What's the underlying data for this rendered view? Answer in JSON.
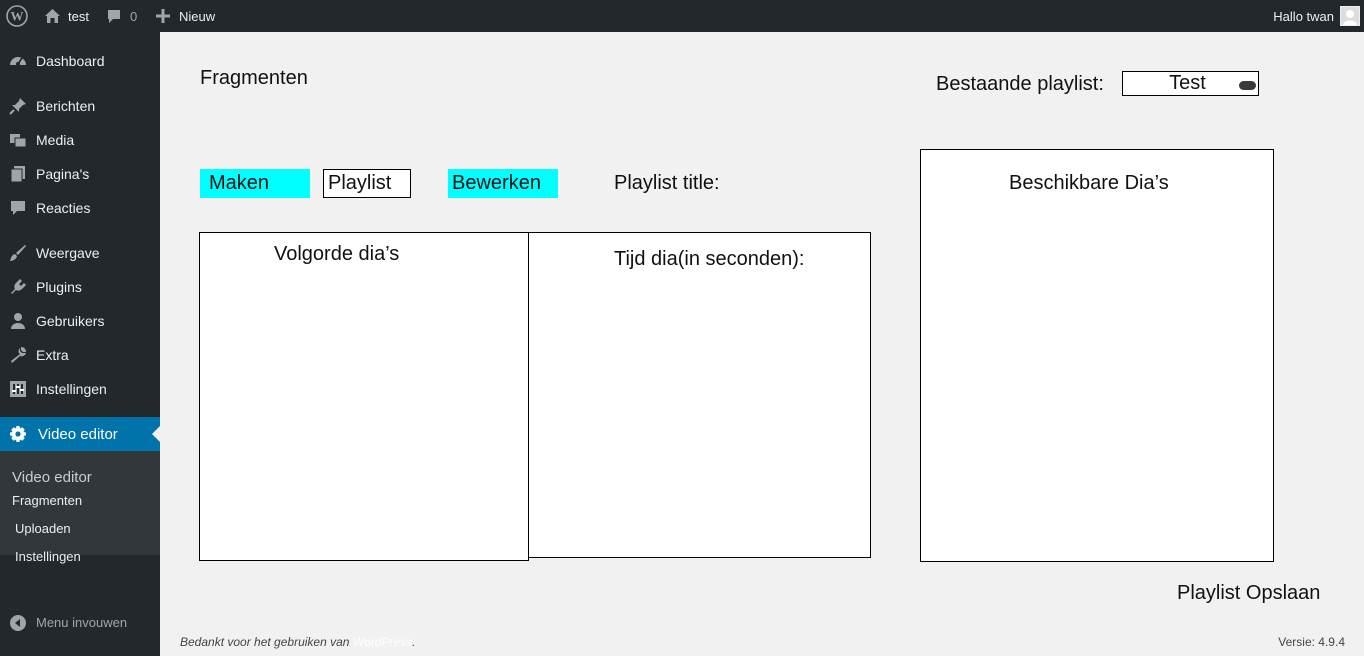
{
  "adminbar": {
    "site_name": "test",
    "comments_count": "0",
    "new_label": "Nieuw",
    "greeting": "Hallo twan"
  },
  "sidebar": {
    "items": [
      {
        "label": "Dashboard",
        "icon": "dashboard-icon"
      },
      {
        "label": "Berichten",
        "icon": "pin-icon"
      },
      {
        "label": "Media",
        "icon": "media-icon"
      },
      {
        "label": "Pagina's",
        "icon": "pages-icon"
      },
      {
        "label": "Reacties",
        "icon": "comment-icon"
      },
      {
        "label": "Weergave",
        "icon": "brush-icon"
      },
      {
        "label": "Plugins",
        "icon": "plugin-icon"
      },
      {
        "label": "Gebruikers",
        "icon": "user-icon"
      },
      {
        "label": "Extra",
        "icon": "wrench-icon"
      },
      {
        "label": "Instellingen",
        "icon": "settings-icon"
      }
    ],
    "active": {
      "label": "Video editor",
      "icon": "gear-icon"
    },
    "submenu_title": "Video editor",
    "submenu": [
      "Fragmenten",
      "Uploaden",
      "Instellingen"
    ],
    "collapse_label": "Menu invouwen"
  },
  "main": {
    "title": "Fragmenten",
    "existing_playlist_label": "Bestaande playlist:",
    "existing_playlist_value": "Test",
    "buttons": {
      "maken": "Maken",
      "playlist": "Playlist",
      "bewerken": "Bewerken"
    },
    "playlist_title_label": "Playlist title:",
    "volgorde_label": "Volgorde dia’s",
    "tijd_label": "Tijd dia(in seconden):",
    "beschikbare_label": "Beschikbare Dia’s",
    "save_label": "Playlist Opslaan"
  },
  "footer": {
    "thanks_prefix": "Bedankt voor het gebruiken van ",
    "wordpress": "WordPress",
    "suffix": ".",
    "version": "Versie: 4.9.4"
  },
  "colors": {
    "adminbar_bg": "#23282d",
    "active_menu": "#0073aa",
    "cyan_button": "#00ffff",
    "content_bg": "#f1f1f1"
  }
}
